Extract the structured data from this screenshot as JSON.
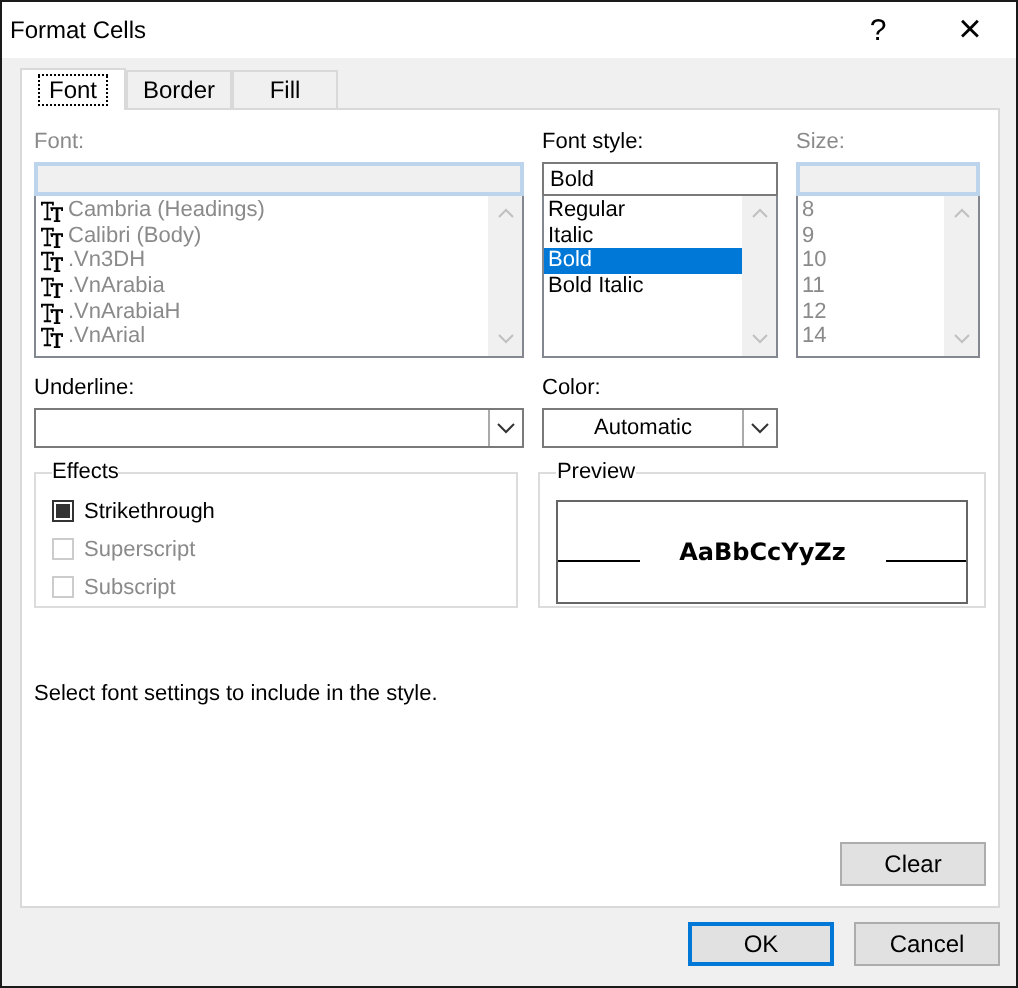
{
  "window": {
    "title": "Format Cells",
    "help": "?",
    "close": "×"
  },
  "tabs": [
    {
      "label": "Font",
      "selected": true
    },
    {
      "label": "Border",
      "selected": false
    },
    {
      "label": "Fill",
      "selected": false
    }
  ],
  "font": {
    "label": "Font:",
    "disabled": true,
    "items": [
      {
        "name": "Cambria (Headings)",
        "selected": false
      },
      {
        "name": "Calibri (Body)",
        "selected": false
      },
      {
        "name": ".Vn3DH",
        "selected": false
      },
      {
        "name": ".VnArabia",
        "selected": false
      },
      {
        "name": ".VnArabiaH",
        "selected": false
      },
      {
        "name": ".VnArial",
        "selected": false
      }
    ]
  },
  "font_style": {
    "label": "Font style:",
    "value": "Bold",
    "disabled": false,
    "items": [
      {
        "name": "Regular",
        "selected": false
      },
      {
        "name": "Italic",
        "selected": false
      },
      {
        "name": "Bold",
        "selected": true
      },
      {
        "name": "Bold Italic",
        "selected": false
      }
    ]
  },
  "size": {
    "label": "Size:",
    "disabled": true,
    "items": [
      {
        "name": "8",
        "selected": false
      },
      {
        "name": "9",
        "selected": false
      },
      {
        "name": "10",
        "selected": false
      },
      {
        "name": "11",
        "selected": false
      },
      {
        "name": "12",
        "selected": false
      },
      {
        "name": "14",
        "selected": false
      }
    ]
  },
  "underline": {
    "label": "Underline:"
  },
  "color": {
    "label": "Color:",
    "value": "Automatic"
  },
  "effects": {
    "title": "Effects",
    "items": [
      {
        "label": "Strikethrough",
        "checked": true,
        "disabled": false
      },
      {
        "label": "Superscript",
        "checked": false,
        "disabled": true
      },
      {
        "label": "Subscript",
        "checked": false,
        "disabled": true
      }
    ]
  },
  "preview": {
    "title": "Preview",
    "sample": "AaBbCcYyZz"
  },
  "hint": "Select font settings to include in the style.",
  "buttons": [
    {
      "label": "Clear",
      "kind": "clear",
      "default": false
    },
    {
      "label": "OK",
      "kind": "footer",
      "default": true
    },
    {
      "label": "Cancel",
      "kind": "footer",
      "default": false
    }
  ]
}
